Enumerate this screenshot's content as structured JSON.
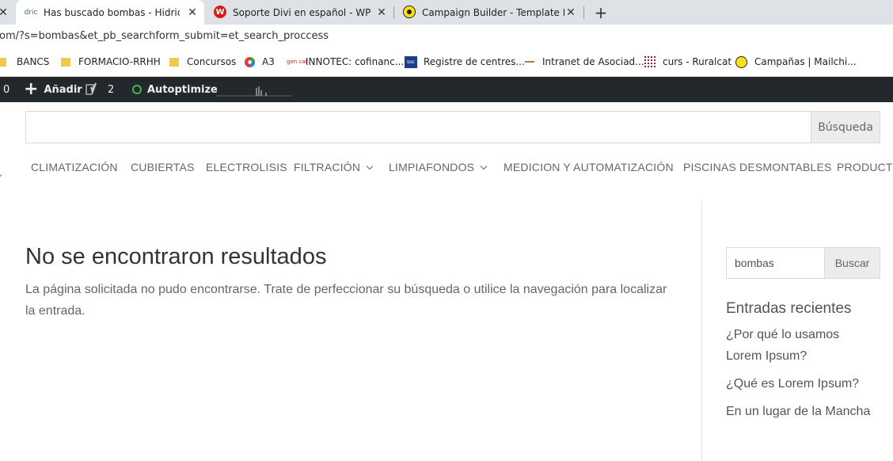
{
  "browser": {
    "tabs": [
      {
        "favicon_text": "dric",
        "title": "Has buscado bombas - Hidricash",
        "active": true
      },
      {
        "favicon_text": "W",
        "title": "Soporte Divi en español - WPFácil",
        "active": false
      },
      {
        "favicon_text": "",
        "title": "Campaign Builder - Template Design",
        "active": false
      }
    ],
    "new_tab_symbol": "+",
    "close_symbol": "✕",
    "url": "om/?s=bombas&et_pb_searchform_submit=et_search_proccess"
  },
  "bookmarks": [
    {
      "label": "BANCS",
      "icon": "folder-icon"
    },
    {
      "label": "FORMACIO-RRHH",
      "icon": "folder-icon"
    },
    {
      "label": "Concursos",
      "icon": "folder-icon"
    },
    {
      "label": "A3",
      "icon": "a3-icon"
    },
    {
      "label": "INNOTEC: cofinanc...",
      "icon": "gencat-icon",
      "icon_text": "gen cat"
    },
    {
      "label": "Registre de centres...",
      "icon": "soc-icon",
      "icon_text": "soc"
    },
    {
      "label": "Intranet de Asociad...",
      "icon": "dash-icon"
    },
    {
      "label": "curs - Ruralcat",
      "icon": "grid-icon"
    },
    {
      "label": "Campañas | Mailchi...",
      "icon": "mailchimp-icon"
    }
  ],
  "adminbar": {
    "count_left": "0",
    "add_label": "Añadir",
    "yoast_count": "2",
    "autoptimize_label": "Autoptimize",
    "status_color": "#46b450"
  },
  "search": {
    "button_label": "Búsqueda",
    "placeholder": ""
  },
  "menu": [
    {
      "label": "CLIMATIZACIÓN",
      "dropdown": false
    },
    {
      "label": "CUBIERTAS",
      "dropdown": false
    },
    {
      "label": "ELECTROLISIS",
      "dropdown": false
    },
    {
      "label": "FILTRACIÓN",
      "dropdown": true
    },
    {
      "label": "LIMPIAFONDOS",
      "dropdown": true
    },
    {
      "label": "MEDICION Y AUTOMATIZACIÓN",
      "dropdown": false
    },
    {
      "label": "PISCINAS DESMONTABLES",
      "dropdown": false
    },
    {
      "label": "PRODUCTOS",
      "dropdown": false
    }
  ],
  "content": {
    "title": "No se encontraron resultados",
    "text": "La página solicitada no pudo encontrarse. Trate de perfeccionar su búsqueda o utilice la navegación para localizar la entrada."
  },
  "sidebar": {
    "search_value": "bombas",
    "search_button": "Buscar",
    "recent_title": "Entradas recientes",
    "recent_posts": [
      "¿Por qué lo usamos Lorem Ipsum?",
      "¿Qué es Lorem Ipsum?",
      "En un lugar de la Mancha"
    ]
  }
}
